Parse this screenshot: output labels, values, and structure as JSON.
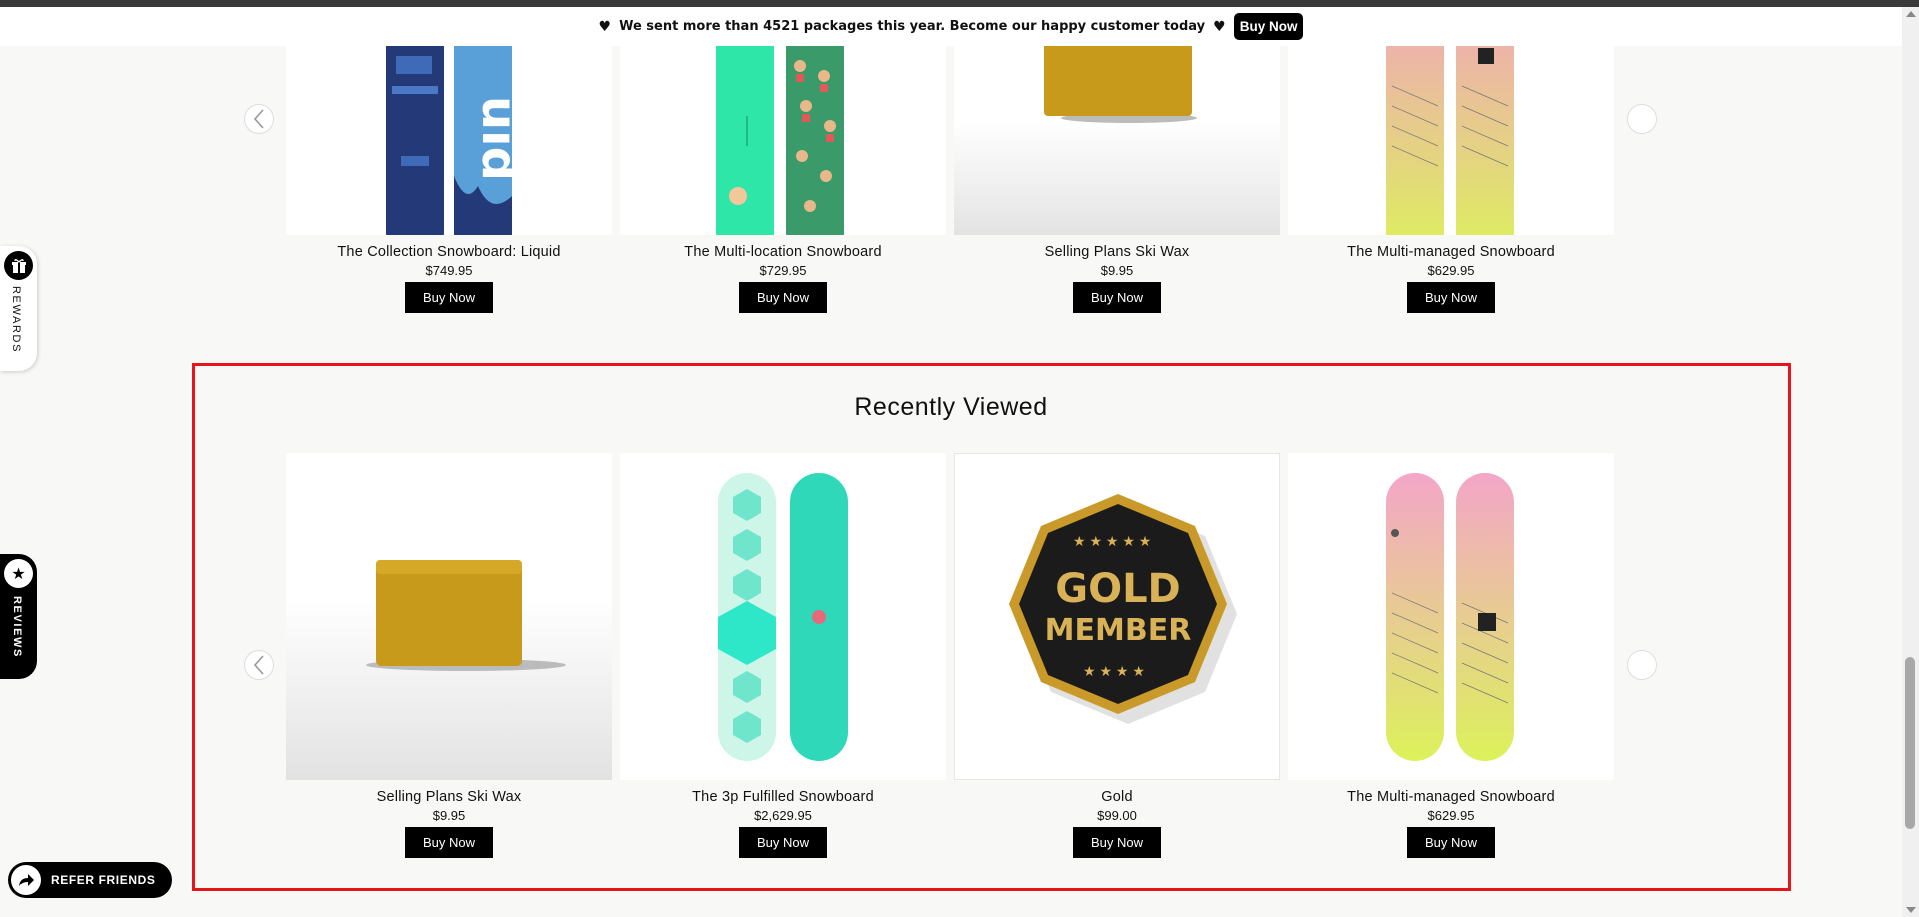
{
  "announcement": {
    "heart_left": "♥",
    "text": "We sent more than 4521 packages this year. Become our happy customer today",
    "heart_right": "♥",
    "button": "Buy Now"
  },
  "top_carousel": {
    "products": [
      {
        "name": "The Collection Snowboard: Liquid",
        "price": "$749.95",
        "button": "Buy Now"
      },
      {
        "name": "The Multi-location Snowboard",
        "price": "$729.95",
        "button": "Buy Now"
      },
      {
        "name": "Selling Plans Ski Wax",
        "price": "$9.95",
        "button": "Buy Now"
      },
      {
        "name": "The Multi-managed Snowboard",
        "price": "$629.95",
        "button": "Buy Now"
      }
    ]
  },
  "recently_viewed": {
    "title": "Recently Viewed",
    "products": [
      {
        "name": "Selling Plans Ski Wax",
        "price": "$9.95",
        "button": "Buy Now"
      },
      {
        "name": "The 3p Fulfilled Snowboard",
        "price": "$2,629.95",
        "button": "Buy Now"
      },
      {
        "name": "Gold",
        "price": "$99.00",
        "button": "Buy Now"
      },
      {
        "name": "The Multi-managed Snowboard",
        "price": "$629.95",
        "button": "Buy Now"
      }
    ],
    "badge_text": {
      "line1": "GOLD",
      "line2": "MEMBER"
    }
  },
  "side_tabs": {
    "rewards": "REWARDS",
    "reviews": "REVIEWS",
    "refer": "REFER FRIENDS"
  },
  "colors": {
    "highlight_border": "#e8141c",
    "button_bg": "#000000",
    "page_bg": "#f8f8f6"
  },
  "icons": {
    "rewards": "gift-icon",
    "reviews": "star-icon",
    "refer": "share-arrow-icon",
    "carousel_prev": "chevron-left-icon",
    "carousel_next": "chevron-right-icon"
  }
}
